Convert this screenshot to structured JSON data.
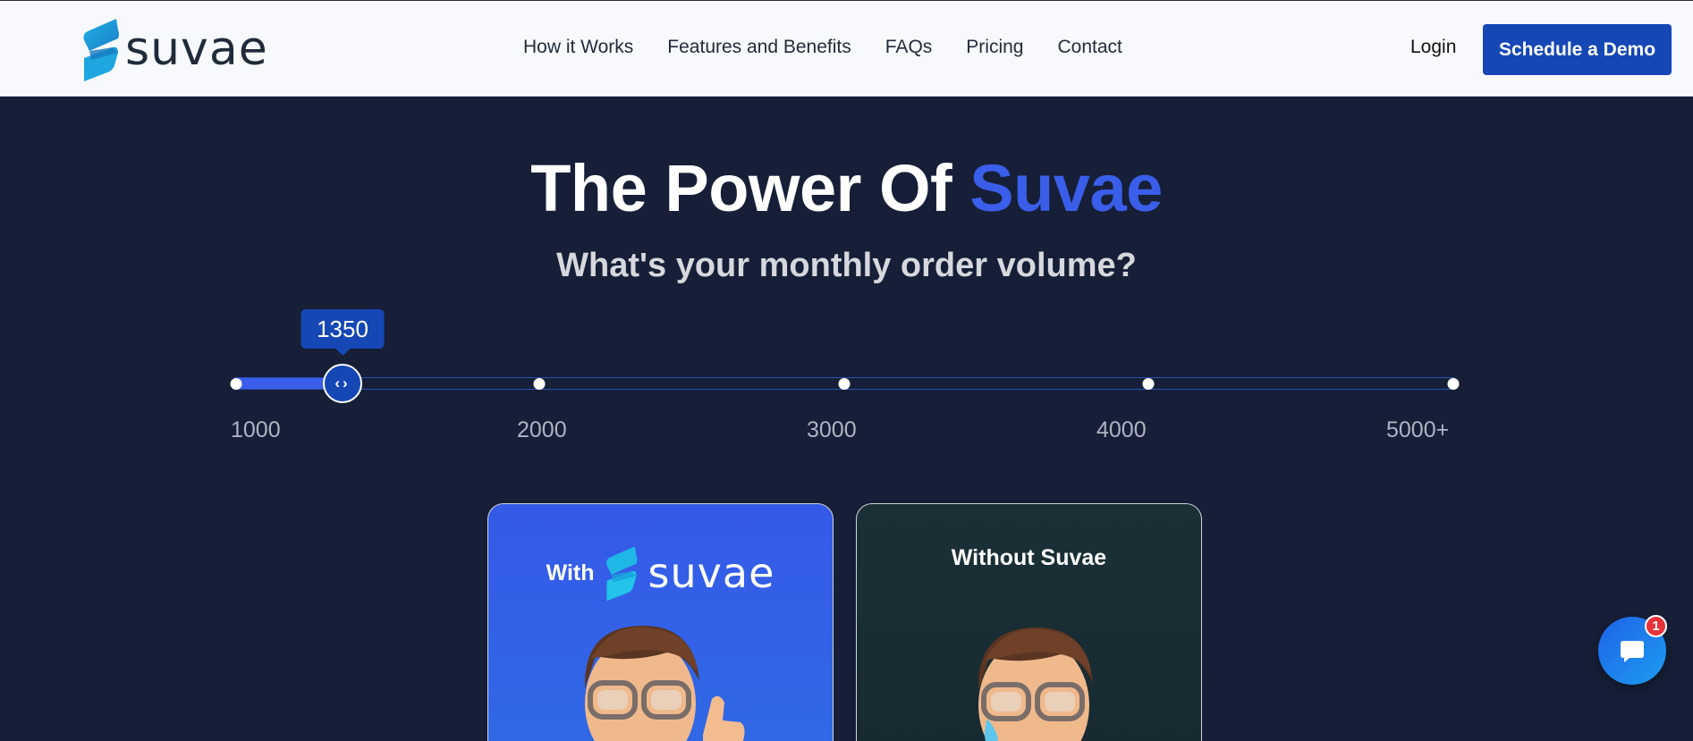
{
  "brand": {
    "name": "suvae"
  },
  "nav": {
    "links": [
      "How it Works",
      "Features and Benefits",
      "FAQs",
      "Pricing",
      "Contact"
    ],
    "login": "Login",
    "cta": "Schedule a Demo"
  },
  "hero": {
    "title_prefix": "The Power Of ",
    "title_accent": "Suvae",
    "subtitle": "What's your monthly order volume?"
  },
  "slider": {
    "value": 1350,
    "value_label": "1350",
    "min": 1000,
    "max": 5000,
    "tick_labels": [
      "1000",
      "2000",
      "3000",
      "4000",
      "5000+"
    ]
  },
  "cards": {
    "with_prefix": "With",
    "with_logo": "suvae",
    "without_label": "Without Suvae"
  },
  "chat": {
    "badge_count": "1"
  },
  "colors": {
    "background": "#161f37",
    "accent": "#3a5eea",
    "primary_button": "#1547b5",
    "navbar": "#f8f9fc"
  },
  "icons": {
    "logo": "suvae-s-logo-icon",
    "thumb": "drag-arrows-icon",
    "chat": "chat-bubble-icon",
    "avatar_happy": "thumbs-up-avatar",
    "avatar_sad": "crying-avatar"
  }
}
